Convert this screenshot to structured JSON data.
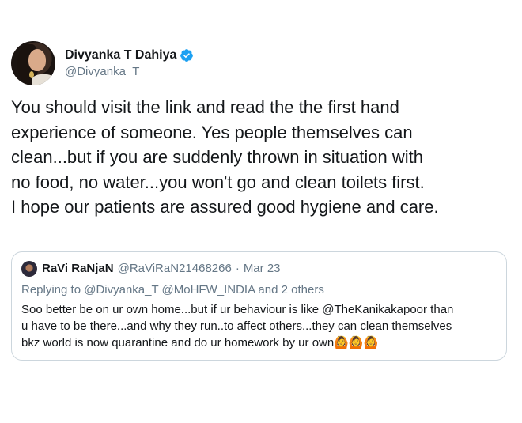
{
  "tweet": {
    "author": {
      "display_name": "Divyanka T Dahiya",
      "handle": "@Divyanka_T",
      "verified": true
    },
    "text": "You should visit the link and read the the first hand\nexperience of someone. Yes people themselves can\nclean...but if you are suddenly thrown in situation with\nno food, no water...you won't go and clean toilets first.\nI hope our patients are assured good hygiene and care."
  },
  "quoted": {
    "display_name": "RaVi RaNjaN",
    "handle": "@RaViRaN21468266",
    "separator": "·",
    "date": "Mar 23",
    "replying_to": "Replying to @Divyanka_T @MoHFW_INDIA and 2 others",
    "text": "Soo better be on ur own home...but if ur behaviour is like @TheKanikakapoor than\nu have to be there...and why they run..to affect others...they can clean themselves\nbkz world is now quarantine and do ur homework by ur own",
    "emojis": [
      "🙆",
      "🙆",
      "🙆"
    ]
  },
  "colors": {
    "text_primary": "#14171a",
    "text_secondary": "#657786",
    "verified_blue": "#1da1f2",
    "border": "#ccd6dd"
  },
  "icons": {
    "verified": "verified-badge-icon"
  }
}
